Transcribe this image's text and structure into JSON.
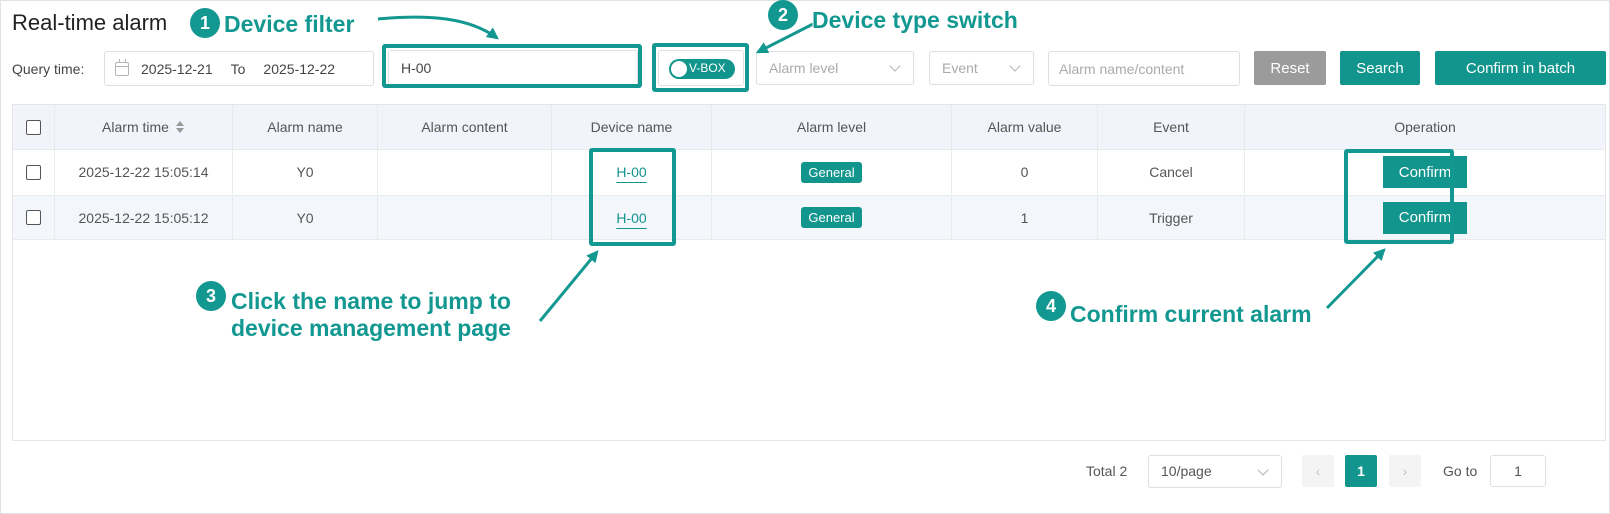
{
  "page": {
    "title": "Real-time alarm"
  },
  "filters": {
    "query_time_label": "Query time:",
    "date_start": "2025-12-21",
    "date_separator": "To",
    "date_end": "2025-12-22",
    "device_value": "H-00",
    "device_type_switch": "V-BOX",
    "alarm_level_placeholder": "Alarm level",
    "event_placeholder": "Event",
    "search_placeholder": "Alarm name/content",
    "reset_label": "Reset",
    "search_label": "Search",
    "batch_label": "Confirm in batch"
  },
  "table": {
    "headers": [
      "Alarm time",
      "Alarm name",
      "Alarm content",
      "Device name",
      "Alarm level",
      "Alarm value",
      "Event",
      "Operation"
    ],
    "rows": [
      {
        "time": "2025-12-22 15:05:14",
        "name": "Y0",
        "content": "",
        "device": "H-00",
        "level": "General",
        "value": "0",
        "event": "Cancel",
        "action": "Confirm"
      },
      {
        "time": "2025-12-22 15:05:12",
        "name": "Y0",
        "content": "",
        "device": "H-00",
        "level": "General",
        "value": "1",
        "event": "Trigger",
        "action": "Confirm"
      }
    ]
  },
  "pagination": {
    "total": "Total 2",
    "page_size": "10/page",
    "prev": "‹",
    "current": "1",
    "next": "›",
    "goto_label": "Go to",
    "goto_value": "1"
  },
  "annotations": [
    {
      "num": "1",
      "text": "Device filter"
    },
    {
      "num": "2",
      "text": "Device type switch"
    },
    {
      "num": "3",
      "line1": "Click the name to jump to",
      "line2": "device management page"
    },
    {
      "num": "4",
      "text": "Confirm current alarm"
    }
  ],
  "colors": {
    "accent": "#12958c",
    "reset": "#9b9b9b",
    "header_bg": "#f1f4fa"
  }
}
